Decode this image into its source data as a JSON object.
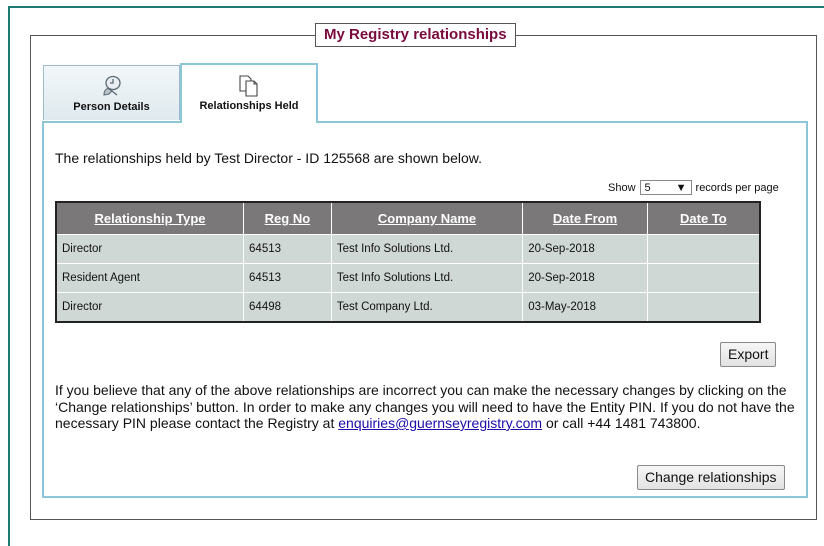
{
  "page": {
    "title": "My Registry relationships"
  },
  "tabs": [
    {
      "label": "Person Details",
      "icon": "person-details-icon",
      "active": false
    },
    {
      "label": "Relationships Held",
      "icon": "documents-icon",
      "active": true
    }
  ],
  "intro": "The relationships held by Test Director - ID 125568 are shown below.",
  "pager": {
    "show": "Show",
    "value": "5",
    "suffix": "records per page"
  },
  "table": {
    "headers": [
      "Relationship Type",
      "Reg No",
      "Company Name",
      "Date From",
      "Date To"
    ],
    "rows": [
      [
        "Director",
        "64513",
        "Test Info Solutions Ltd.",
        "20-Sep-2018",
        ""
      ],
      [
        "Resident Agent",
        "64513",
        "Test Info Solutions Ltd.",
        "20-Sep-2018",
        ""
      ],
      [
        "Director",
        "64498",
        "Test Company Ltd.",
        "03-May-2018",
        ""
      ]
    ]
  },
  "buttons": {
    "export": "Export",
    "change": "Change relationships"
  },
  "info": {
    "before": "If you believe that any of the above relationships are incorrect you can make the necessary changes by clicking on the ‘Change relationships’ button. In order to make any changes you will need to have the Entity PIN. If you do not have the necessary PIN please contact the Registry at",
    "email": "enquiries@guernseyregistry.com",
    "after": "or call +44 1481 743800."
  },
  "colors": {
    "frame": "#1d7a73",
    "title": "#7a0a3c",
    "tab_border": "#8dc6d8",
    "header": "#7b787a",
    "cell": "#cfd8d4"
  }
}
